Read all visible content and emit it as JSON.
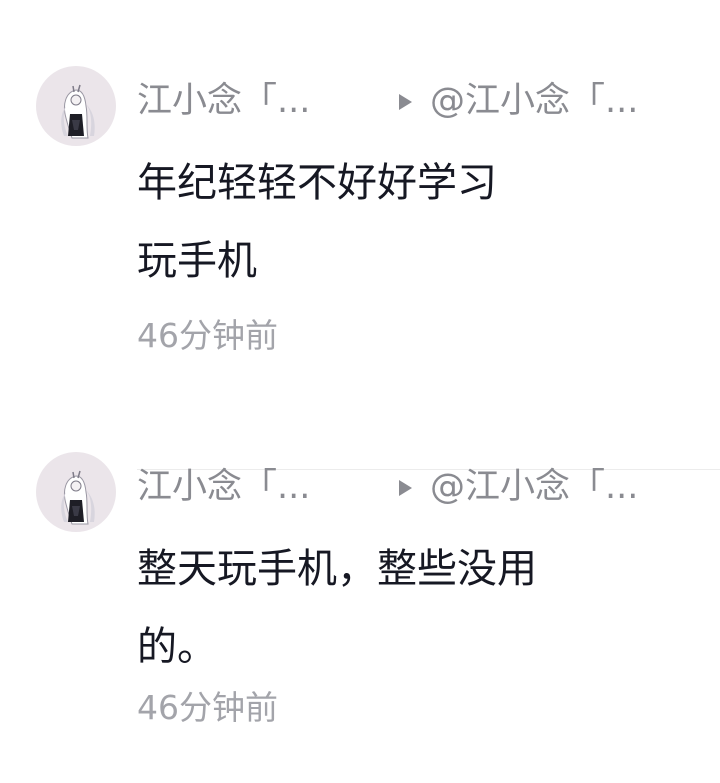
{
  "comments": [
    {
      "author": "江小念「...",
      "reply_to": "@江小念「...",
      "text": "年纪轻轻不好好学习\n 玩手机",
      "time": "46分钟前"
    },
    {
      "author": "江小念「...",
      "reply_to": "@江小念「...",
      "text": "整天玩手机，整些没用\n的。",
      "time": "46分钟前"
    }
  ],
  "icons": {
    "avatar": "anime-girl-avatar",
    "reply_arrow": "play-triangle-icon"
  },
  "colors": {
    "text_primary": "#161823",
    "text_secondary": "#8a8b91",
    "time": "#a3a4aa",
    "avatar_bg": "#ebe5ea",
    "divider": "#ececec"
  }
}
